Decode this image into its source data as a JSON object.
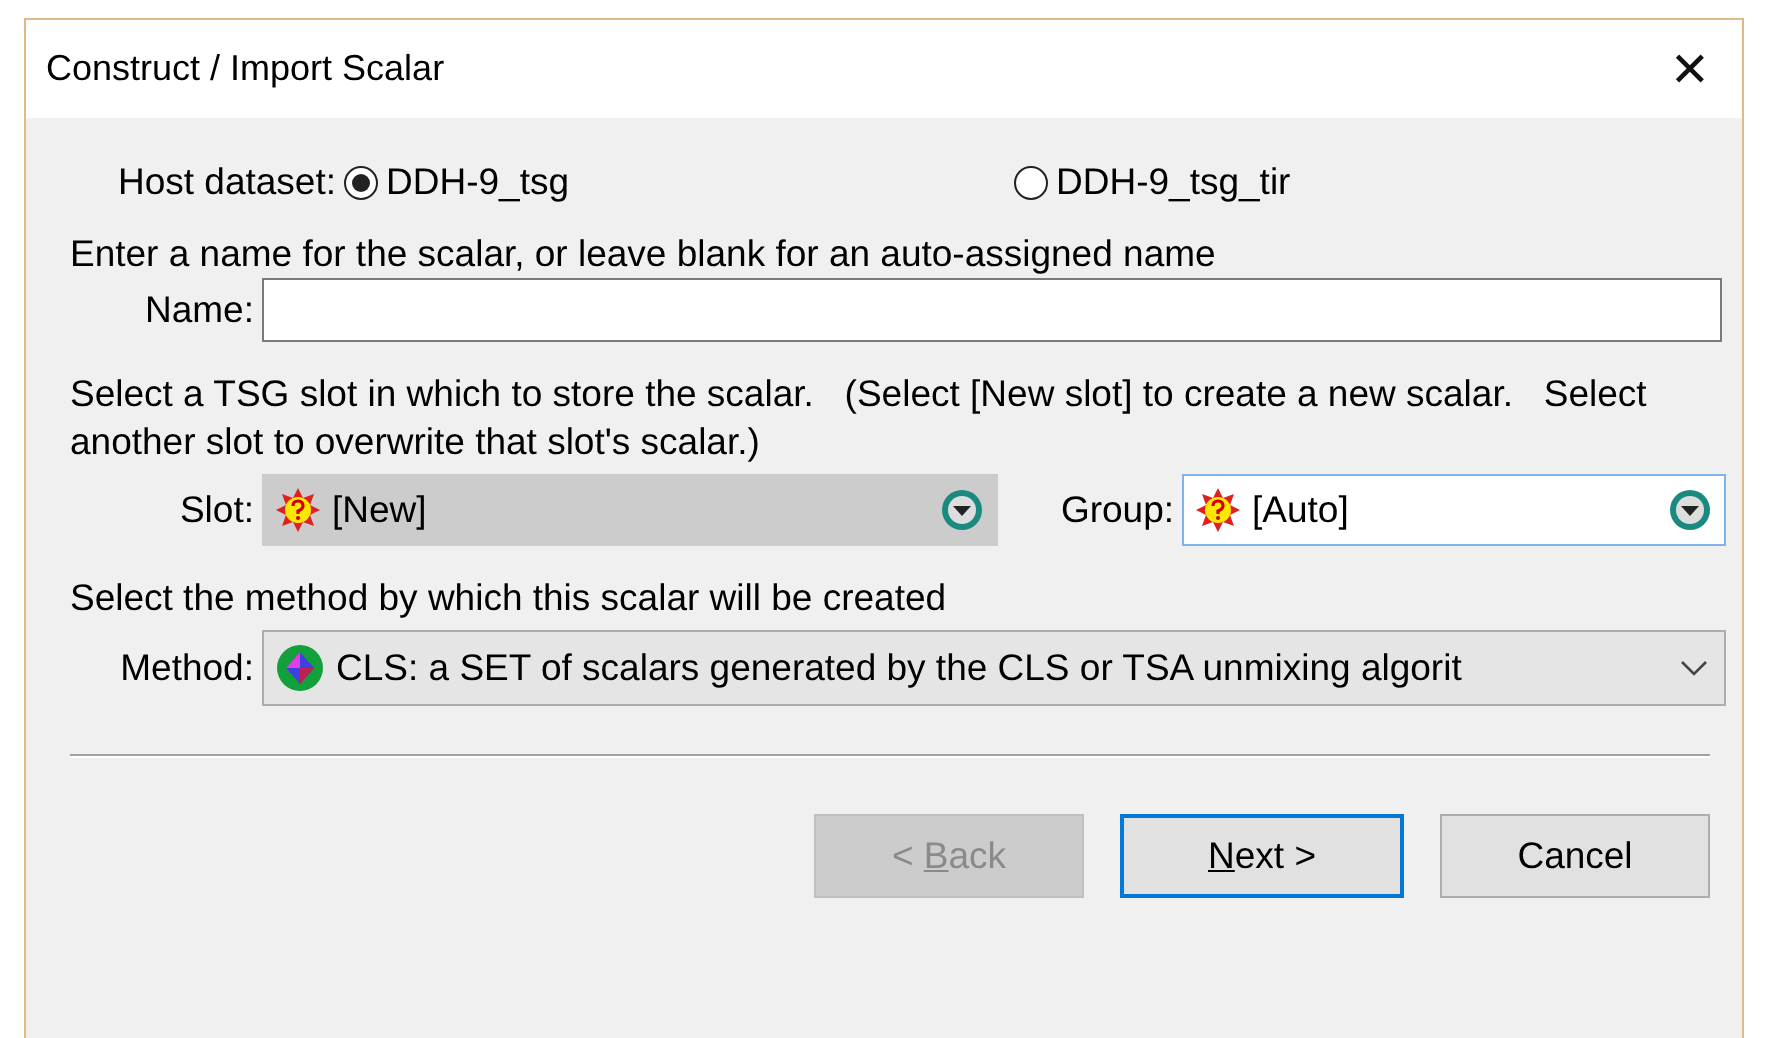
{
  "window": {
    "title": "Construct / Import Scalar",
    "close": "✕"
  },
  "host": {
    "label": "Host dataset:",
    "options": [
      {
        "label": "DDH-9_tsg",
        "selected": true
      },
      {
        "label": "DDH-9_tsg_tir",
        "selected": false
      }
    ]
  },
  "name_prompt": "Enter a name for the scalar, or leave blank for an auto-assigned name",
  "name_field": {
    "label": "Name:"
  },
  "slot_prompt": "Select a TSG slot in which to store the scalar.   (Select [New slot] to create a new scalar.   Select another slot to overwrite that slot's scalar.)",
  "slot": {
    "label": "Slot:",
    "value": "[New]",
    "disabled": true
  },
  "group": {
    "label": "Group:",
    "value": "[Auto]",
    "disabled": false
  },
  "method_prompt": "Select the method by which this scalar will be created",
  "method": {
    "label": "Method:",
    "value": "CLS:  a SET of scalars generated by the CLS or TSA unmixing algorit"
  },
  "buttons": [
    {
      "before": "< ",
      "key": "B",
      "after": "ack",
      "disabled": true,
      "focused": false
    },
    {
      "key": "N",
      "after": "ext >",
      "disabled": false,
      "focused": true
    },
    {
      "after": "Cancel",
      "disabled": false,
      "focused": false
    }
  ]
}
